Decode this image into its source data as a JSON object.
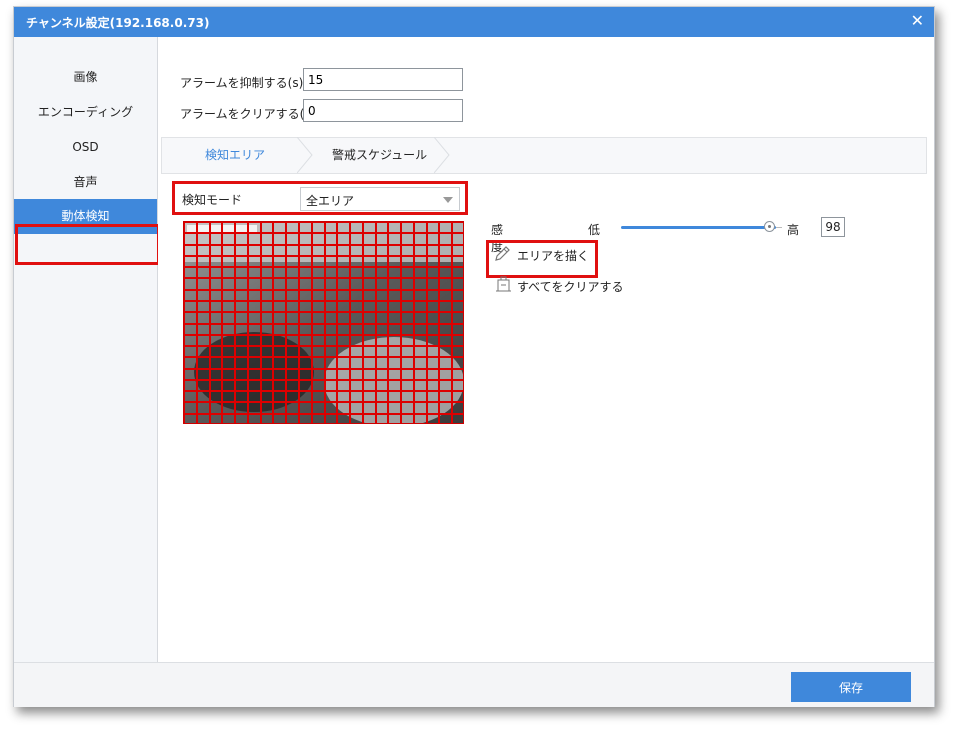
{
  "window": {
    "title": "チャンネル設定(192.168.0.73)",
    "close_symbol": "✕"
  },
  "sidebar": {
    "items": [
      {
        "label": "画像"
      },
      {
        "label": "エンコーディング"
      },
      {
        "label": "OSD"
      },
      {
        "label": "音声"
      },
      {
        "label": "動体検知"
      }
    ],
    "active": "動体検知"
  },
  "alarm": {
    "suppress_label": "アラームを抑制する(s)",
    "suppress_value": "15",
    "clear_label": "アラームをクリアする(s)",
    "clear_value": "0"
  },
  "tabs": [
    {
      "label": "検知エリア",
      "active": true
    },
    {
      "label": "警戒スケジュール",
      "active": false
    }
  ],
  "detection": {
    "mode_label": "検知モード",
    "mode_value": "全エリア",
    "grid": {
      "rows": 18,
      "cols": 22,
      "color": "#dd0000"
    }
  },
  "sensitivity": {
    "label": "感度",
    "low_label": "低",
    "high_label": "高",
    "value": "98",
    "level_percent": 98,
    "accent": "#3f88db"
  },
  "actions": {
    "draw_area": "エリアを描く",
    "clear_all": "すべてをクリアする",
    "draw_icon": "pencil-icon",
    "clear_icon": "eraser-icon"
  },
  "footer": {
    "save_label": "保存"
  },
  "colors": {
    "titlebar": "#3f88db",
    "highlight": "#e01010"
  }
}
